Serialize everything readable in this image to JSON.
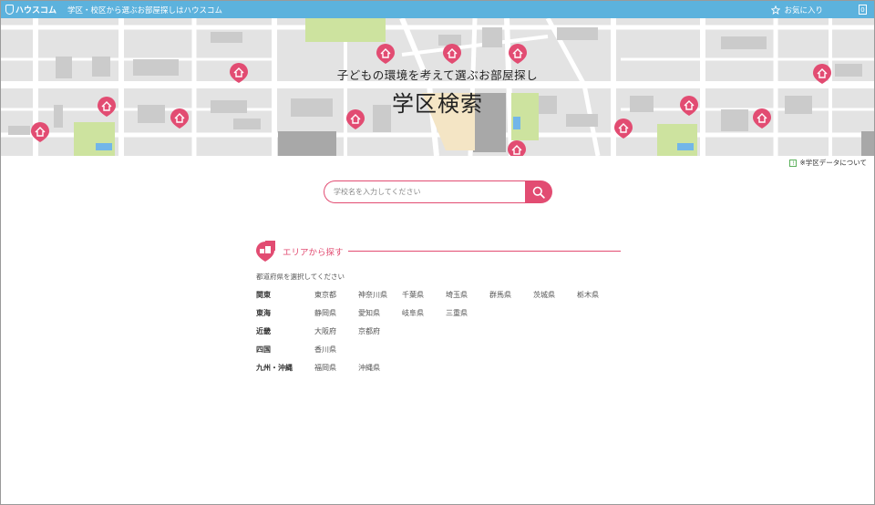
{
  "header": {
    "logo_text": "ハウスコム",
    "tagline": "学区・校区から選ぶお部屋探しはハウスコム",
    "favorites_label": "お気に入り",
    "favorites_count": "0",
    "colors": {
      "bar": "#5cb2dd",
      "accent": "#e24c72"
    }
  },
  "hero": {
    "subtitle": "子どもの環境を考えて選ぶお部屋探し",
    "title": "学区検索"
  },
  "data_note": "※学区データについて",
  "search": {
    "placeholder": "学校名を入力してください",
    "button_icon": "search-icon"
  },
  "area": {
    "title": "エリアから探す",
    "instruction": "都道府県を選択してください",
    "regions": [
      {
        "name": "関東",
        "prefs": [
          "東京都",
          "神奈川県",
          "千葉県",
          "埼玉県",
          "群馬県",
          "茨城県",
          "栃木県"
        ]
      },
      {
        "name": "東海",
        "prefs": [
          "静岡県",
          "愛知県",
          "岐阜県",
          "三重県"
        ]
      },
      {
        "name": "近畿",
        "prefs": [
          "大阪府",
          "京都府"
        ]
      },
      {
        "name": "四国",
        "prefs": [
          "香川県"
        ]
      },
      {
        "name": "九州・沖縄",
        "prefs": [
          "福岡県",
          "沖縄県"
        ]
      }
    ]
  }
}
